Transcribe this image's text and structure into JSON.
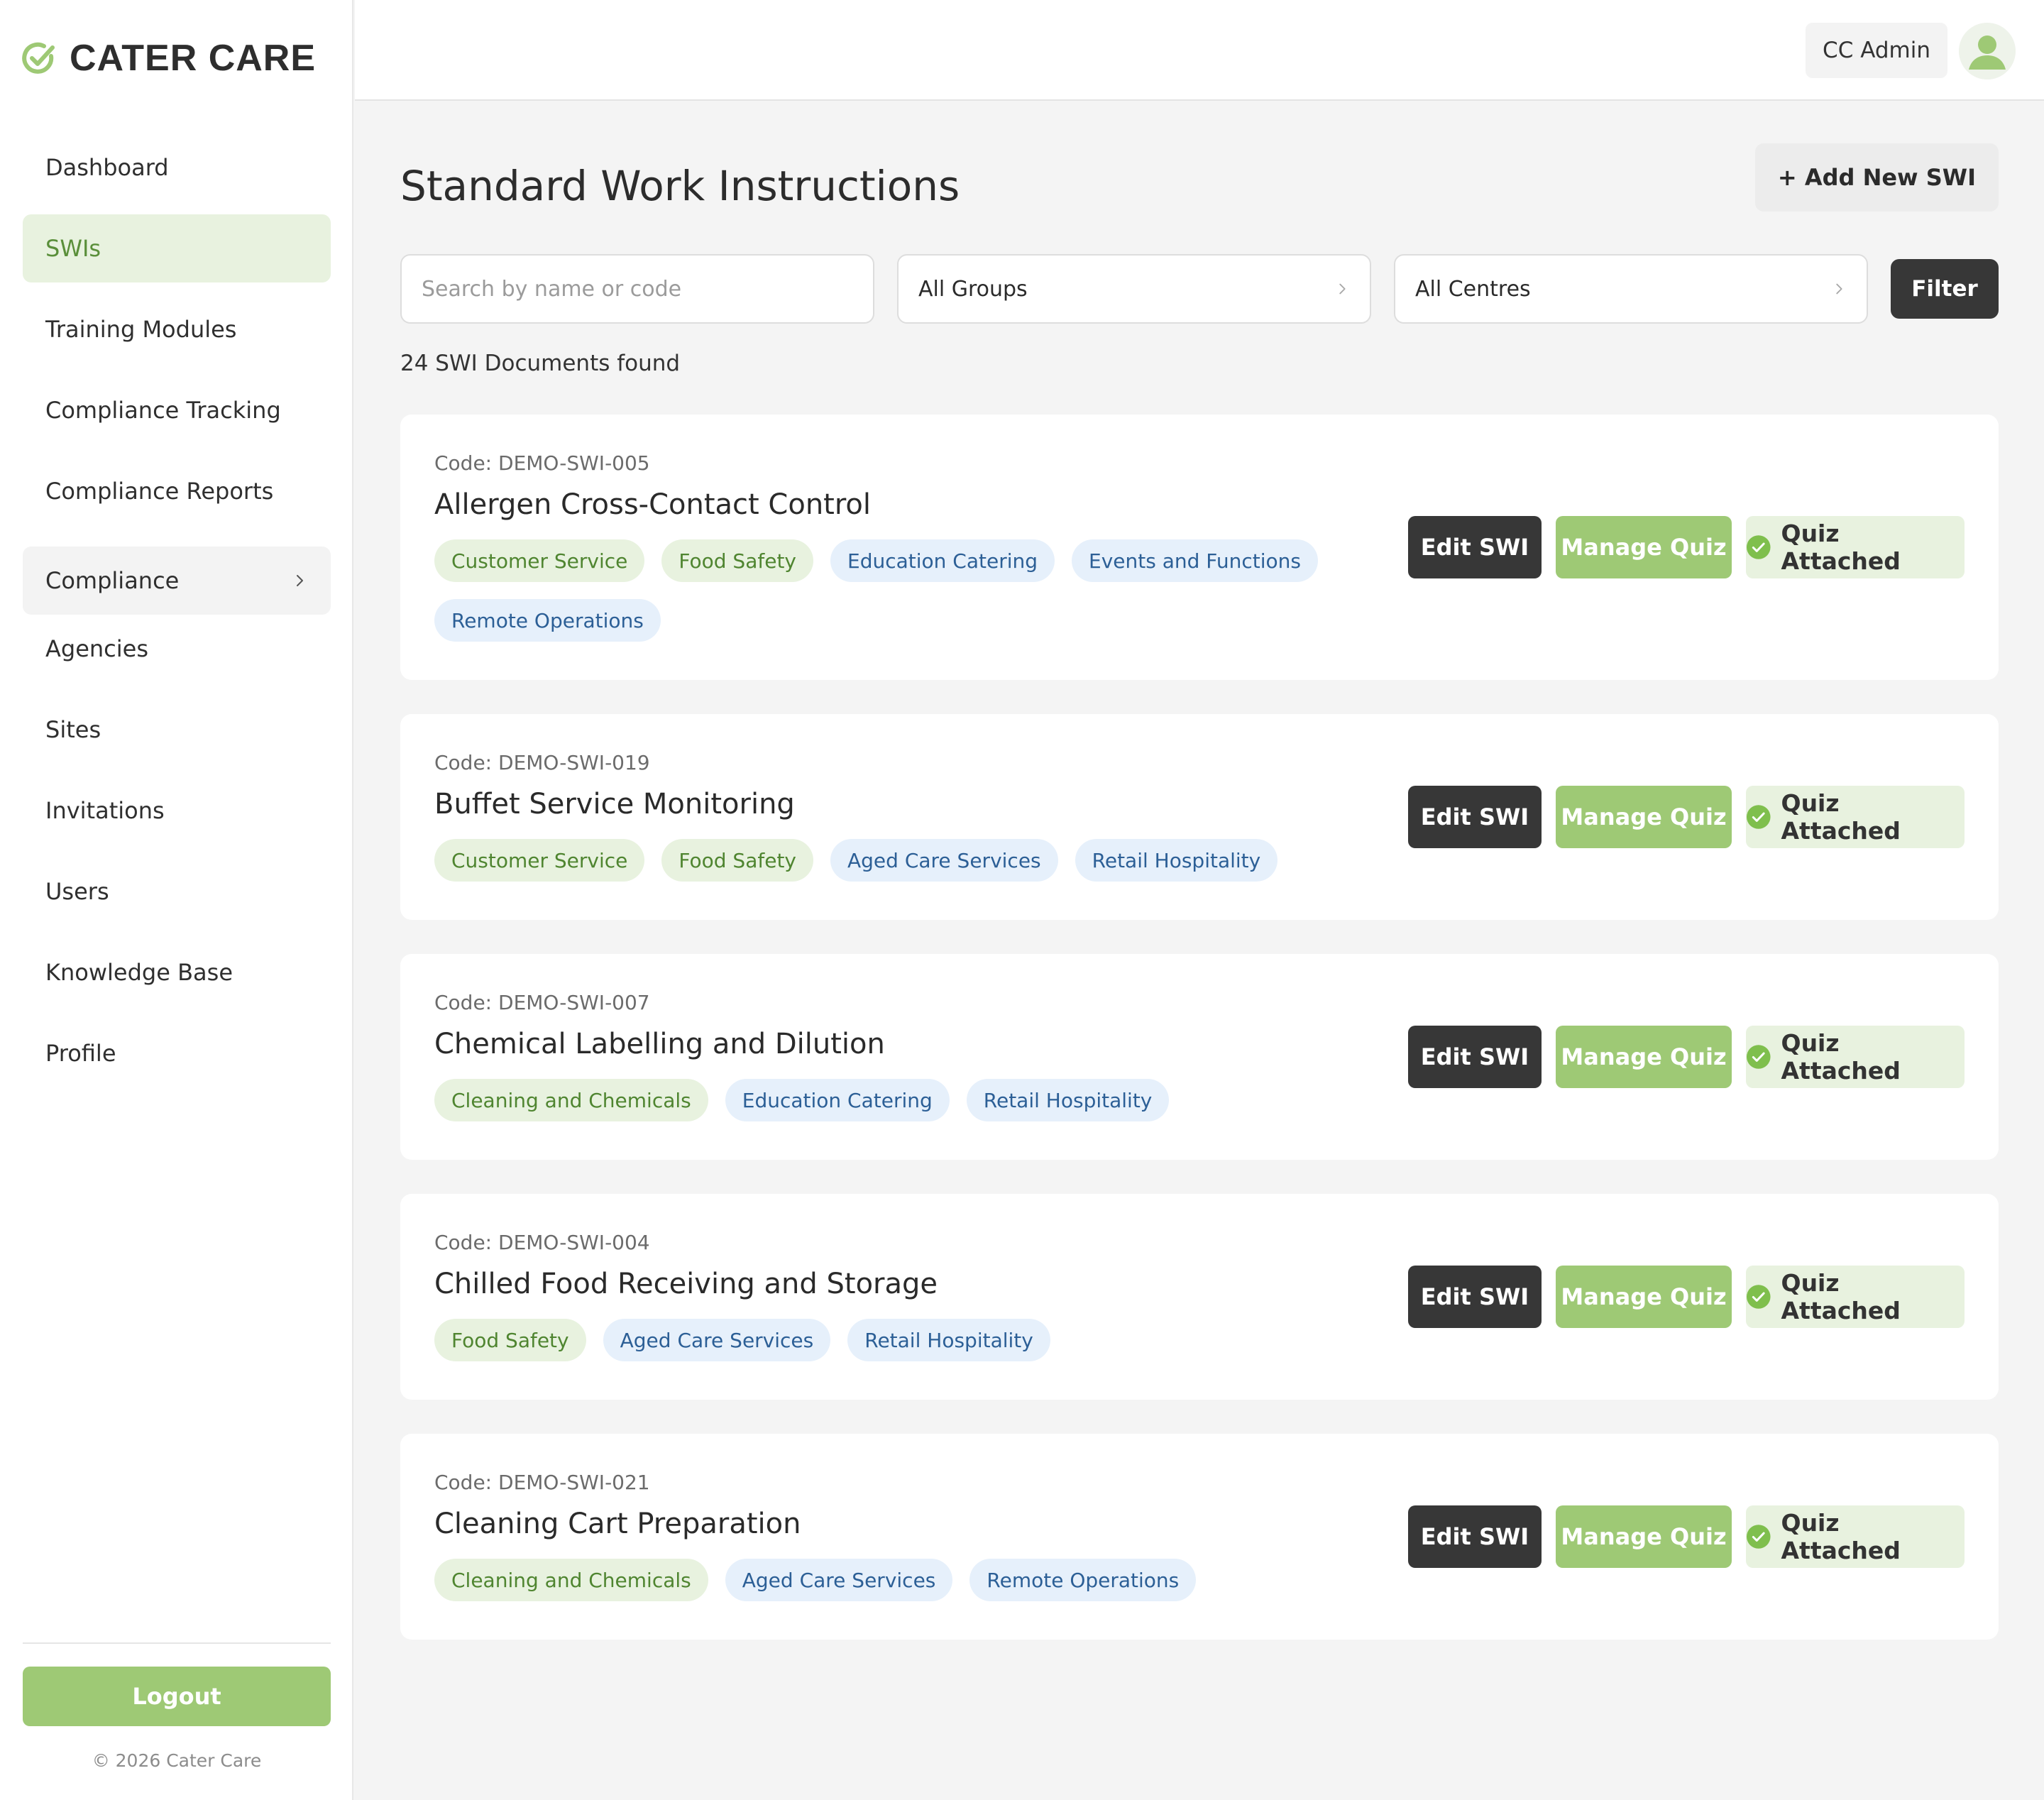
{
  "brand": {
    "name": "CATER CARE"
  },
  "sidebar": {
    "items": [
      {
        "label": "Dashboard",
        "active": false
      },
      {
        "label": "SWIs",
        "active": true
      },
      {
        "label": "Training Modules",
        "active": false
      },
      {
        "label": "Compliance Tracking",
        "active": false
      },
      {
        "label": "Compliance Reports",
        "active": false
      },
      {
        "label": "Compliance",
        "active": false,
        "expandable": true
      },
      {
        "label": "Agencies",
        "active": false
      },
      {
        "label": "Sites",
        "active": false
      },
      {
        "label": "Invitations",
        "active": false
      },
      {
        "label": "Users",
        "active": false
      },
      {
        "label": "Knowledge Base",
        "active": false
      },
      {
        "label": "Profile",
        "active": false
      }
    ],
    "logout_label": "Logout",
    "copyright": "© 2026 Cater Care"
  },
  "header": {
    "user_name": "CC Admin",
    "avatar_icon": "user-avatar-icon"
  },
  "page": {
    "title": "Standard Work Instructions",
    "add_button_label": "+ Add New SWI",
    "search": {
      "placeholder": "Search by name or code",
      "value": ""
    },
    "groups_select": {
      "value": "All Groups"
    },
    "centres_select": {
      "value": "All Centres"
    },
    "filter_label": "Filter",
    "results_count": "24 SWI Documents found"
  },
  "swis": [
    {
      "code": "Code: DEMO-SWI-005",
      "title": "Allergen Cross-Contact Control",
      "tags": [
        {
          "label": "Customer Service",
          "kind": "green"
        },
        {
          "label": "Food Safety",
          "kind": "green"
        },
        {
          "label": "Education Catering",
          "kind": "blue"
        },
        {
          "label": "Events and Functions",
          "kind": "blue"
        },
        {
          "label": "Remote Operations",
          "kind": "blue"
        }
      ],
      "edit_label": "Edit SWI",
      "quiz_label": "Manage Quiz",
      "status_label": "Quiz Attached"
    },
    {
      "code": "Code: DEMO-SWI-019",
      "title": "Buffet Service Monitoring",
      "tags": [
        {
          "label": "Customer Service",
          "kind": "green"
        },
        {
          "label": "Food Safety",
          "kind": "green"
        },
        {
          "label": "Aged Care Services",
          "kind": "blue"
        },
        {
          "label": "Retail Hospitality",
          "kind": "blue"
        }
      ],
      "edit_label": "Edit SWI",
      "quiz_label": "Manage Quiz",
      "status_label": "Quiz Attached"
    },
    {
      "code": "Code: DEMO-SWI-007",
      "title": "Chemical Labelling and Dilution",
      "tags": [
        {
          "label": "Cleaning and Chemicals",
          "kind": "green"
        },
        {
          "label": "Education Catering",
          "kind": "blue"
        },
        {
          "label": "Retail Hospitality",
          "kind": "blue"
        }
      ],
      "edit_label": "Edit SWI",
      "quiz_label": "Manage Quiz",
      "status_label": "Quiz Attached"
    },
    {
      "code": "Code: DEMO-SWI-004",
      "title": "Chilled Food Receiving and Storage",
      "tags": [
        {
          "label": "Food Safety",
          "kind": "green"
        },
        {
          "label": "Aged Care Services",
          "kind": "blue"
        },
        {
          "label": "Retail Hospitality",
          "kind": "blue"
        }
      ],
      "edit_label": "Edit SWI",
      "quiz_label": "Manage Quiz",
      "status_label": "Quiz Attached"
    },
    {
      "code": "Code: DEMO-SWI-021",
      "title": "Cleaning Cart Preparation",
      "tags": [
        {
          "label": "Cleaning and Chemicals",
          "kind": "green"
        },
        {
          "label": "Aged Care Services",
          "kind": "blue"
        },
        {
          "label": "Remote Operations",
          "kind": "blue"
        }
      ],
      "edit_label": "Edit SWI",
      "quiz_label": "Manage Quiz",
      "status_label": "Quiz Attached"
    }
  ],
  "colors": {
    "accent_green": "#9ec975",
    "accent_green_light": "#e8f2df",
    "dark_button": "#373737",
    "tag_blue_bg": "#e6f0fb",
    "tag_blue_text": "#2c5f96"
  }
}
